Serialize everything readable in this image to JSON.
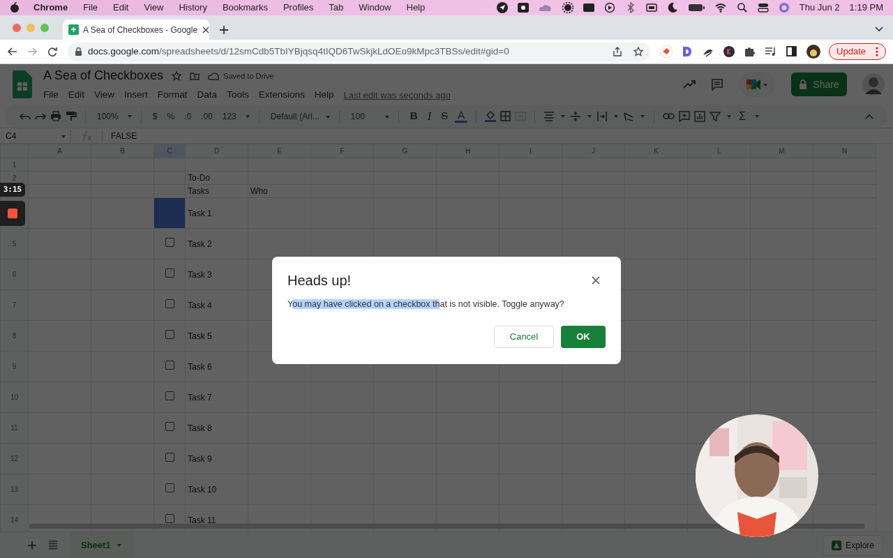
{
  "menu_bar": {
    "app": "Chrome",
    "items": [
      "File",
      "Edit",
      "View",
      "History",
      "Bookmarks",
      "Profiles",
      "Tab",
      "Window",
      "Help"
    ],
    "date": "Thu Jun 2",
    "time": "1:19 PM"
  },
  "browser": {
    "tab_title": "A Sea of Checkboxes - Google",
    "url_host": "docs.google.com",
    "url_path": "/spreadsheets/d/12smCdb5TbIYBjqsq4tIQD6TwSkjkLdOEo9kMpc3TBSs/edit#gid=0",
    "update": "Update"
  },
  "sheets": {
    "title": "A Sea of Checkboxes",
    "saved": "Saved to Drive",
    "menus": [
      "File",
      "Edit",
      "View",
      "Insert",
      "Format",
      "Data",
      "Tools",
      "Extensions",
      "Help"
    ],
    "last_edit": "Last edit was seconds ago",
    "share": "Share"
  },
  "toolbar": {
    "zoom": "100%",
    "currency": "$",
    "percent": "%",
    "decrease_decimal": ".0",
    "increase_decimal": ".00",
    "number_format": "123",
    "font": "Default (Ari...",
    "font_size": "100",
    "bold": "B",
    "italic": "I",
    "strikethrough": "S",
    "text_color": "A",
    "functions": "Σ"
  },
  "formula_bar": {
    "cell_ref": "C4",
    "formula": "FALSE"
  },
  "columns": [
    {
      "label": "A",
      "selected": false
    },
    {
      "label": "B",
      "selected": false
    },
    {
      "label": "C",
      "selected": true
    },
    {
      "label": "D",
      "selected": false
    },
    {
      "label": "E",
      "selected": false
    },
    {
      "label": "F",
      "selected": false
    },
    {
      "label": "G",
      "selected": false
    },
    {
      "label": "H",
      "selected": false
    },
    {
      "label": "I",
      "selected": false
    },
    {
      "label": "J",
      "selected": false
    },
    {
      "label": "K",
      "selected": false
    },
    {
      "label": "L",
      "selected": false
    },
    {
      "label": "M",
      "selected": false
    },
    {
      "label": "N",
      "selected": false
    }
  ],
  "rows": [
    {
      "number": "1",
      "selected": false,
      "c": {
        "kind": "empty",
        "selected": false
      }
    },
    {
      "number": "2",
      "selected": false,
      "c": {
        "kind": "empty",
        "selected": false
      },
      "d": "To-Do"
    },
    {
      "c": {
        "kind": "empty",
        "selected": false
      },
      "d": "Tasks",
      "e": "Who"
    },
    {
      "c": {
        "kind": "empty",
        "selected": true
      },
      "d": "Task 1"
    },
    {
      "number": "5",
      "selected": false,
      "c": {
        "kind": "checkbox",
        "checked": false,
        "selected": false
      },
      "d": "Task 2"
    },
    {
      "number": "6",
      "selected": false,
      "c": {
        "kind": "checkbox",
        "checked": false,
        "selected": false
      },
      "d": "Task 3"
    },
    {
      "number": "7",
      "selected": false,
      "c": {
        "kind": "checkbox",
        "checked": false,
        "selected": false
      },
      "d": "Task 4"
    },
    {
      "number": "8",
      "selected": false,
      "c": {
        "kind": "checkbox",
        "checked": false,
        "selected": false
      },
      "d": "Task 5"
    },
    {
      "number": "9",
      "selected": false,
      "c": {
        "kind": "checkbox",
        "checked": false,
        "selected": false
      },
      "d": "Task 6"
    },
    {
      "number": "10",
      "selected": false,
      "c": {
        "kind": "checkbox",
        "checked": false,
        "selected": false
      },
      "d": "Task 7"
    },
    {
      "number": "11",
      "selected": false,
      "c": {
        "kind": "checkbox",
        "checked": false,
        "selected": false
      },
      "d": "Task 8"
    },
    {
      "number": "12",
      "selected": false,
      "c": {
        "kind": "checkbox",
        "checked": false,
        "selected": false
      },
      "d": "Task 9"
    },
    {
      "number": "13",
      "selected": false,
      "c": {
        "kind": "checkbox",
        "checked": false,
        "selected": false
      },
      "d": "Task 10"
    },
    {
      "number": "14",
      "selected": false,
      "c": {
        "kind": "checkbox",
        "checked": false,
        "selected": false
      },
      "d": "Task 11"
    }
  ],
  "sheet_tabs": [
    {
      "label": "Sheet1",
      "selected": true
    }
  ],
  "explore": "Explore",
  "recorder": {
    "timer": "3:15"
  },
  "dialog": {
    "title": "Heads up!",
    "message": [
      {
        "text": "Y",
        "highlighted": false
      },
      {
        "text": "ou may have clicked on a checkbox th",
        "highlighted": true
      },
      {
        "text": "at is not visible. Toggle anyway?",
        "highlighted": false
      }
    ],
    "cancel": "Cancel",
    "ok": "OK"
  }
}
